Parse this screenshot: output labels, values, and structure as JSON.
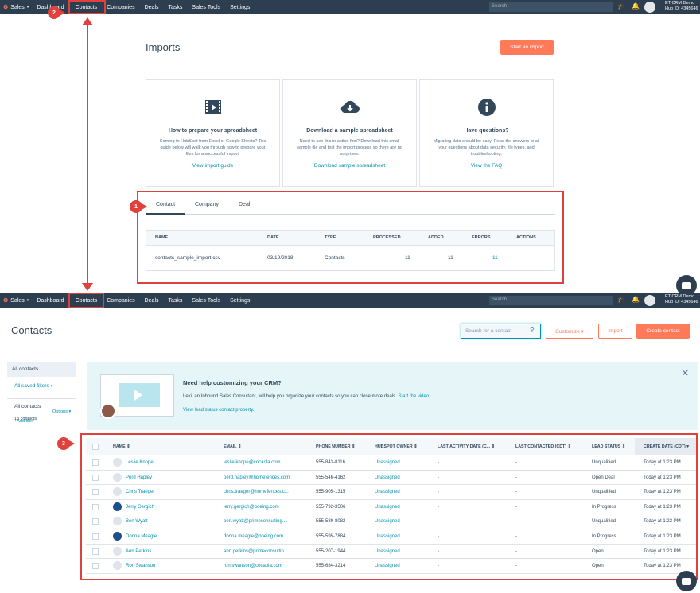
{
  "nav": {
    "brand": "Sales",
    "items": [
      "Dashboard",
      "Contacts",
      "Companies",
      "Deals",
      "Tasks",
      "Sales Tools",
      "Settings"
    ],
    "search_placeholder": "Search",
    "hub_name": "ET CRM Demo",
    "hub_id": "Hub ID: 4345646"
  },
  "annotations": [
    "1",
    "2",
    "3"
  ],
  "imports": {
    "title": "Imports",
    "start_button": "Start an import",
    "cards": [
      {
        "icon": "film-icon",
        "title": "How to prepare your spreadsheet",
        "desc": "Coming to HubSpot from Excel or Google Sheets? The guide below will walk you through how to prepare your files for a successful import.",
        "link": "View import guide"
      },
      {
        "icon": "cloud-download-icon",
        "title": "Download a sample spreadsheet",
        "desc": "Need to see this in action first? Download this small sample file and test the import process so there are no surprises.",
        "link": "Download sample spreadsheet"
      },
      {
        "icon": "info-icon",
        "title": "Have questions?",
        "desc": "Migrating data should be easy. Read the answers to all your questions about data security, file types, and troubleshooting.",
        "link": "View the FAQ"
      }
    ],
    "tabs": [
      "Contact",
      "Company",
      "Deal"
    ],
    "table": {
      "headers": [
        "NAME",
        "DATE",
        "TYPE",
        "PROCESSED",
        "ADDED",
        "ERRORS",
        "ACTIONS"
      ],
      "row": [
        "contacts_sample_import.csv",
        "03/19/2018",
        "Contacts",
        "11",
        "11",
        "11",
        ""
      ]
    }
  },
  "contacts": {
    "title": "Contacts",
    "search_placeholder": "Search for a contact",
    "customize_button": "Customize ▾",
    "import_button": "Import",
    "create_button": "Create contact",
    "sidebar": {
      "all_contacts": "All contacts",
      "all_saved_filters": "All saved filters ›",
      "list_name": "All contacts",
      "count": "13 contacts",
      "options": "Options ▾",
      "add_filter": "+Add filter"
    },
    "banner": {
      "title": "Need help customizing your CRM?",
      "desc": "Lexi, an Inbound Sales Consultant, will help you organize your contacts so you can close more deals.",
      "desc_link": "Start the video.",
      "link": "View lead status contact property."
    },
    "columns": [
      "NAME",
      "EMAIL",
      "PHONE NUMBER",
      "HUBSPOT OWNER",
      "LAST ACTIVITY DATE (C...",
      "LAST CONTACTED (CDT)",
      "LEAD STATUS",
      "CREATE DATE (CDT)"
    ],
    "rows": [
      {
        "name": "Leslie Knope",
        "email": "leslie.knope@cocaola.com",
        "phone": "555-843-8116",
        "owner": "Unassigned",
        "activity": "-",
        "contacted": "-",
        "status": "Unqualified",
        "created": "Today at 1:23 PM",
        "company": false
      },
      {
        "name": "Perd Hapley",
        "email": "perd.hapley@homefences.com",
        "phone": "555-546-4162",
        "owner": "Unassigned",
        "activity": "-",
        "contacted": "-",
        "status": "Open Deal",
        "created": "Today at 1:23 PM",
        "company": false
      },
      {
        "name": "Chris Traeger",
        "email": "chris.traeger@homefences.c...",
        "phone": "555-905-1315",
        "owner": "Unassigned",
        "activity": "-",
        "contacted": "-",
        "status": "Unqualified",
        "created": "Today at 1:23 PM",
        "company": false
      },
      {
        "name": "Jerry Gergich",
        "email": "jerry.gergich@boeing.com",
        "phone": "555-792-3506",
        "owner": "Unassigned",
        "activity": "-",
        "contacted": "-",
        "status": "In Progress",
        "created": "Today at 1:23 PM",
        "company": true
      },
      {
        "name": "Ben Wyatt",
        "email": "ben.wyatt@primeconsulting....",
        "phone": "555-589-8082",
        "owner": "Unassigned",
        "activity": "-",
        "contacted": "-",
        "status": "Unqualified",
        "created": "Today at 1:23 PM",
        "company": false
      },
      {
        "name": "Donna Meagle",
        "email": "donna.meagle@boeing.com",
        "phone": "555-595-7884",
        "owner": "Unassigned",
        "activity": "-",
        "contacted": "-",
        "status": "In Progress",
        "created": "Today at 1:23 PM",
        "company": true
      },
      {
        "name": "Ann Perkins",
        "email": "ann.perkins@primeconsultin...",
        "phone": "555-207-1944",
        "owner": "Unassigned",
        "activity": "-",
        "contacted": "-",
        "status": "Open",
        "created": "Today at 1:23 PM",
        "company": false
      },
      {
        "name": "Ron Swanson",
        "email": "ron.swanson@cocaola.com",
        "phone": "555-684-3214",
        "owner": "Unassigned",
        "activity": "-",
        "contacted": "-",
        "status": "Open",
        "created": "Today at 1:23 PM",
        "company": false
      }
    ]
  },
  "colors": {
    "nav": "#2d3e50",
    "accent": "#ff7a59",
    "link": "#0091ae",
    "highlight": "#e0413d"
  }
}
